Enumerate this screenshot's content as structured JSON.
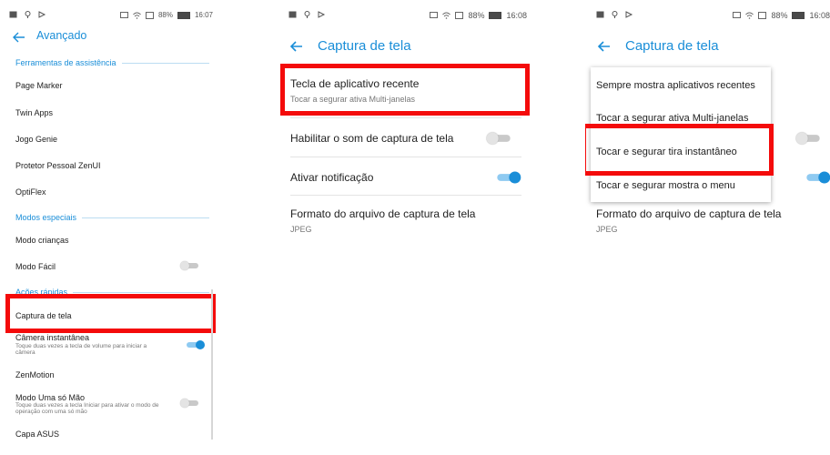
{
  "status_bar": {
    "left_icons": [
      "image-icon",
      "location-icon",
      "cast-icon"
    ],
    "right_icons": [
      "cast-screen-icon",
      "wifi-icon",
      "battery-saver-icon"
    ],
    "battery": "88%",
    "times": [
      "16:07",
      "16:08",
      "16:08"
    ]
  },
  "screen1": {
    "title": "Avançado",
    "sections": {
      "tools": "Ferramentas de assistência",
      "special": "Modos especiais",
      "quick": "Ações rápidas"
    },
    "items": {
      "page_marker": "Page Marker",
      "twin_apps": "Twin Apps",
      "jogo_genie": "Jogo Genie",
      "protetor": "Protetor Pessoal ZenUI",
      "optiflex": "OptiFlex",
      "modo_criancas": "Modo crianças",
      "modo_facil": "Modo Fácil",
      "captura": "Captura de tela",
      "camera": "Câmera instantânea",
      "camera_sub": "Toque duas vezes a tecla de volume para iniciar a câmera",
      "zenmotion": "ZenMotion",
      "uma_mao": "Modo Uma só Mão",
      "uma_mao_sub": "Toque duas vezes a tecla Iniciar para ativar o modo de operação com uma só mão",
      "capa": "Capa ASUS"
    },
    "toggles": {
      "modo_facil": false,
      "camera": true,
      "uma_mao": false
    }
  },
  "screen2": {
    "title": "Captura de tela",
    "recent_key": {
      "label": "Tecla de aplicativo recente",
      "sub": "Tocar a segurar ativa Multi-janelas"
    },
    "sound": {
      "label": "Habilitar o som de captura de tela",
      "on": false
    },
    "notify": {
      "label": "Ativar notificação",
      "on": true
    },
    "format": {
      "label": "Formato do arquivo de captura de tela",
      "value": "JPEG"
    }
  },
  "screen3": {
    "title": "Captura de tela",
    "options": [
      "Sempre mostra aplicativos recentes",
      "Tocar a segurar ativa Multi-janelas",
      "Tocar e segurar tira instantâneo",
      "Tocar e segurar mostra o menu"
    ],
    "format": {
      "label": "Formato do arquivo de captura de tela",
      "value": "JPEG"
    }
  },
  "colors": {
    "accent": "#1a8ed8",
    "highlight": "#f40b0b"
  }
}
